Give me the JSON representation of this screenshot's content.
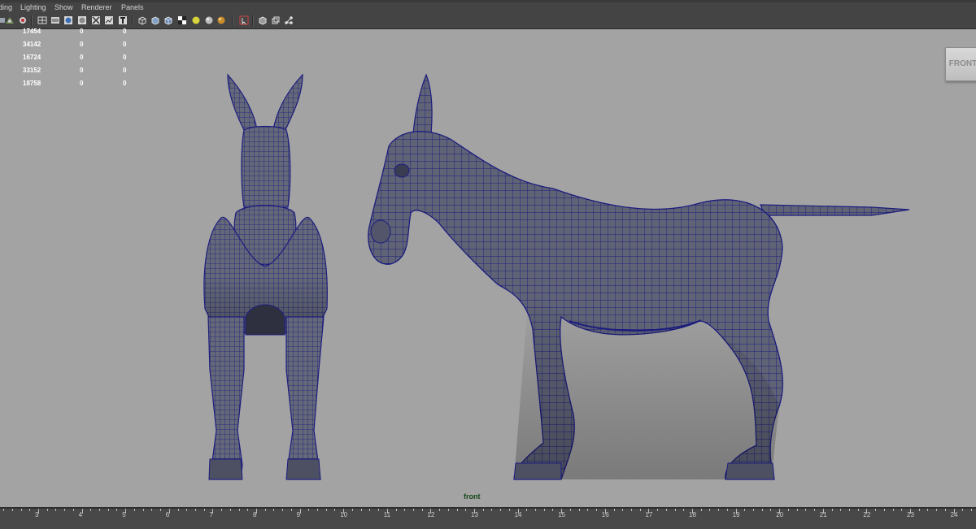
{
  "menubar": {
    "items": [
      {
        "label": "ding"
      },
      {
        "label": "Lighting"
      },
      {
        "label": "Show"
      },
      {
        "label": "Renderer"
      },
      {
        "label": "Panels"
      }
    ]
  },
  "toolbar": {
    "icons": [
      "select-camera-icon",
      "camera-attributes-icon",
      "bookmark-icon",
      "wireframe-icon",
      "smooth-shade-icon",
      "textured-icon",
      "use-lights-icon",
      "xray-icon",
      "grid-icon",
      "resolution-gate-icon",
      "field-chart-icon",
      "safe-action-icon",
      "wireframe-on-shaded-icon",
      "shaded-cube-icon",
      "texture-cube-icon",
      "checker-icon",
      "sphere-gray-icon",
      "sphere-yellow-icon",
      "sphere-orange-icon",
      "isolate-select-icon",
      "xray-joints-icon",
      "xray-active-icon",
      "node-editor-icon"
    ]
  },
  "hud": {
    "rows": [
      [
        "17454",
        "0",
        "0"
      ],
      [
        "34142",
        "0",
        "0"
      ],
      [
        "16724",
        "0",
        "0"
      ],
      [
        "33152",
        "0",
        "0"
      ],
      [
        "18758",
        "0",
        "0"
      ]
    ]
  },
  "viewcube": {
    "label": "FRONT"
  },
  "viewport": {
    "camera_name": "front",
    "background_color": "#a3a3a3",
    "wireframe_color": "#1c1c7e",
    "mesh_fill_color": "#5f6375"
  },
  "timeslider": {
    "labels": [
      "3",
      "4",
      "5",
      "6",
      "7",
      "8",
      "9",
      "10",
      "11",
      "12",
      "13",
      "14",
      "15",
      "16",
      "17",
      "18",
      "19",
      "20",
      "21",
      "22",
      "23",
      "24"
    ]
  }
}
